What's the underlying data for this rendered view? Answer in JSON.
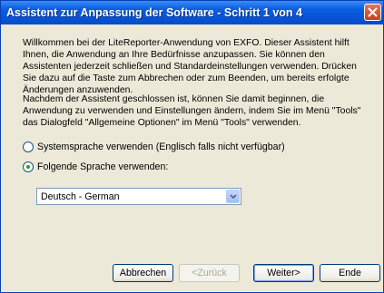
{
  "window": {
    "title": "Assistent zur Anpassung der Software - Schritt 1 von 4"
  },
  "intro": {
    "paragraph1": "Willkommen bei der LiteReporter-Anwendung von EXFO. Dieser Assistent hilft Ihnen, die Anwendung an Ihre Bedürfnisse anzupassen. Sie können den Assistenten jederzeit schließen und Standardeinstellungen verwenden. Drücken Sie dazu auf die Taste zum Abbrechen oder zum Beenden, um bereits erfolgte Änderungen anzuwenden.",
    "paragraph2": "Nachdem der Assistent geschlossen ist, können Sie damit beginnen, die Anwendung zu verwenden und Einstellungen ändern, indem Sie im Menü \"Tools\" das Dialogfeld \"Allgemeine Optionen\" im Menü \"Tools\" verwenden."
  },
  "language": {
    "option_system": "Systemsprache verwenden (Englisch falls nicht verfügbar)",
    "option_following": "Folgende Sprache verwenden:",
    "selected_option": "following",
    "selected_language": "Deutsch - German"
  },
  "buttons": {
    "cancel": "Abbrechen",
    "back": "<Zurück",
    "next": "Weiter>",
    "finish": "Ende"
  },
  "colors": {
    "titlebar": "#0a5ee0",
    "dialog_bg": "#ece9d8",
    "close_button": "#c3401e"
  }
}
